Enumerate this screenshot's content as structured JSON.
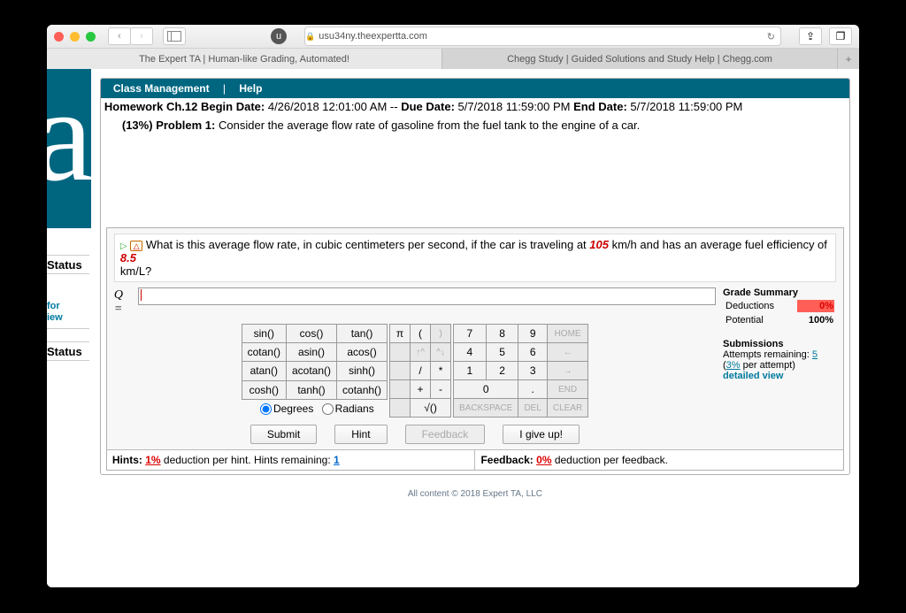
{
  "browser": {
    "url": "usu34ny.theexpertta.com"
  },
  "tabs": {
    "t1": "The Expert TA | Human-like Grading, Automated!",
    "t2": "Chegg Study | Guided Solutions and Study Help | Chegg.com"
  },
  "menu": {
    "cm": "Class Management",
    "help": "Help",
    "sep": "|"
  },
  "hw": {
    "title": "Homework Ch.12",
    "begin_l": "Begin Date:",
    "begin": "4/26/2018 12:01:00 AM",
    "sep": "--",
    "due_l": "Due Date:",
    "due": "5/7/2018 11:59:00 PM",
    "end_l": "End Date:",
    "end": "5/7/2018 11:59:00 PM"
  },
  "prob": {
    "pct": "(13%)",
    "lbl": "Problem 1:",
    "txt": "Consider the average flow rate of gasoline from the fuel tank to the engine of a car."
  },
  "side": {
    "status": "Status",
    "for": "for",
    "iew": "iew"
  },
  "q": {
    "pre": "What is this average flow rate, in cubic centimeters per second, if the car is traveling at ",
    "v1": "105",
    "mid": " km/h and has an average fuel efficiency of ",
    "v2": "8.5",
    "post": "km/L?",
    "sym": "Q ="
  },
  "sum": {
    "h": "Grade Summary",
    "ded_l": "Deductions",
    "ded": "0%",
    "pot_l": "Potential",
    "pot": "100%",
    "sub": "Submissions",
    "att_l": "Attempts remaining:",
    "att": "5",
    "per_a": "3%",
    "per_b": " per attempt)",
    "dv": "detailed view"
  },
  "keys": {
    "r1": [
      "sin()",
      "cos()",
      "tan()"
    ],
    "r2": [
      "cotan()",
      "asin()",
      "acos()"
    ],
    "r3": [
      "atan()",
      "acotan()",
      "sinh()"
    ],
    "r4": [
      "cosh()",
      "tanh()",
      "cotanh()"
    ],
    "sym": {
      "pi": "π",
      "lp": "(",
      "rp": ")"
    },
    "num": {
      "n7": "7",
      "n8": "8",
      "n9": "9",
      "n4": "4",
      "n5": "5",
      "n6": "6",
      "n1": "1",
      "n2": "2",
      "n3": "3",
      "n0": "0",
      "dot": ".",
      "div": "/",
      "mul": "*",
      "add": "+",
      "sub": "-",
      "sqrt": "√()"
    },
    "sp": {
      "home": "HOME",
      "end": "END",
      "bksp": "BACKSPACE",
      "del": "DEL",
      "clear": "CLEAR",
      "up": "↑^",
      "dn": "^↓",
      "lt": "←",
      "rt": "→"
    },
    "deg": "Degrees",
    "rad": "Radians"
  },
  "act": {
    "submit": "Submit",
    "hint": "Hint",
    "fb": "Feedback",
    "give": "I give up!"
  },
  "hints": {
    "l": "Hints:",
    "p": "1%",
    "t": "deduction per hint. Hints remaining:",
    "r": "1"
  },
  "fb": {
    "l": "Feedback:",
    "p": "0%",
    "t": "deduction per feedback."
  },
  "footer": "All content © 2018 Expert TA, LLC"
}
